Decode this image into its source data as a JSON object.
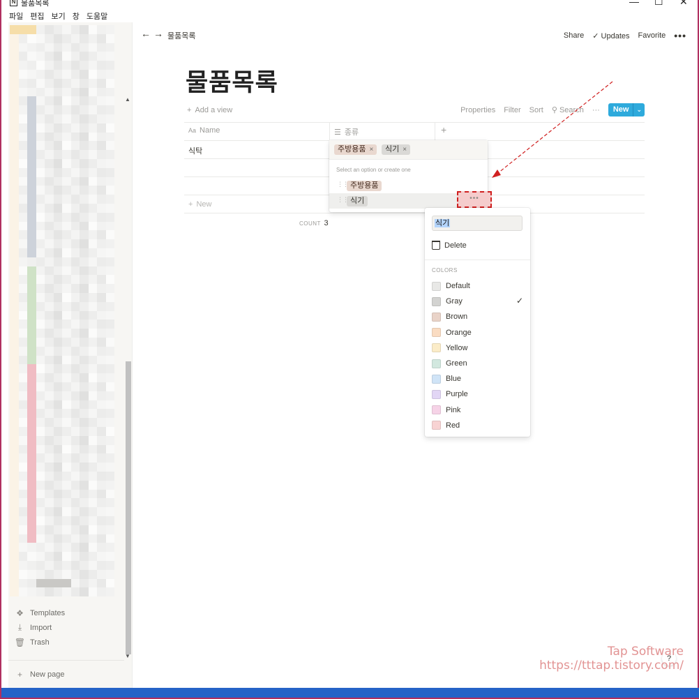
{
  "window": {
    "title": "물품목록",
    "app_icon": "N",
    "controls": {
      "minimize": "—",
      "maximize": "☐",
      "close": "✕"
    }
  },
  "menubar": [
    "파일",
    "편집",
    "보기",
    "창",
    "도움말"
  ],
  "sidebar": {
    "bottom_items": [
      {
        "label": "Templates",
        "icon": "templates-icon"
      },
      {
        "label": "Import",
        "icon": "import-icon"
      },
      {
        "label": "Trash",
        "icon": "trash-icon"
      }
    ],
    "new_page": "New page"
  },
  "topbar": {
    "breadcrumb": "물품목록",
    "share": "Share",
    "updates": "Updates",
    "favorite": "Favorite",
    "more": "•••"
  },
  "page": {
    "title": "물품목록"
  },
  "db_toolbar": {
    "add_view": "Add a view",
    "properties": "Properties",
    "filter": "Filter",
    "sort": "Sort",
    "search": "Search",
    "more": "···",
    "new_button": "New",
    "new_chevron": "⌄"
  },
  "table": {
    "columns": [
      {
        "label": "Name",
        "icon": "Aa"
      },
      {
        "label": "종류",
        "icon": "list-icon"
      }
    ],
    "add_column": "+",
    "rows": [
      {
        "name": "식탁"
      },
      {
        "name": ""
      },
      {
        "name": ""
      }
    ],
    "new_row": "New",
    "count_label": "COUNT",
    "count_value": "3"
  },
  "select_popup": {
    "selected_tags": [
      {
        "label": "주방용품",
        "color": "#e9d8cf"
      },
      {
        "label": "식기",
        "color": "#dad9d6"
      }
    ],
    "remove_glyph": "×",
    "hint": "Select an option or create one",
    "options": [
      {
        "label": "주방용품",
        "color": "#e9d8cf"
      },
      {
        "label": "식기",
        "color": "#dad9d6"
      }
    ],
    "option_more": "•••"
  },
  "context_menu": {
    "input_value": "식기",
    "delete_label": "Delete",
    "colors_heading": "COLORS",
    "colors": [
      {
        "label": "Default",
        "swatch": "#e8e8e6",
        "selected": false
      },
      {
        "label": "Gray",
        "swatch": "#d3d3d1",
        "selected": true
      },
      {
        "label": "Brown",
        "swatch": "#e9d3c8",
        "selected": false
      },
      {
        "label": "Orange",
        "swatch": "#fadcc2",
        "selected": false
      },
      {
        "label": "Yellow",
        "swatch": "#fbecc8",
        "selected": false
      },
      {
        "label": "Green",
        "swatch": "#d2e8df",
        "selected": false
      },
      {
        "label": "Blue",
        "swatch": "#d0e4f7",
        "selected": false
      },
      {
        "label": "Purple",
        "swatch": "#e2d6f5",
        "selected": false
      },
      {
        "label": "Pink",
        "swatch": "#f6d3e7",
        "selected": false
      },
      {
        "label": "Red",
        "swatch": "#f8d3d3",
        "selected": false
      }
    ],
    "check_glyph": "✓"
  },
  "watermark": {
    "line1": "Tap Software",
    "line2": "https://tttap.tistory.com/"
  },
  "help": "?",
  "accent_colors": {
    "new_button": "#2eaadc",
    "annotation": "#d02020",
    "watermark": "#e29393"
  }
}
